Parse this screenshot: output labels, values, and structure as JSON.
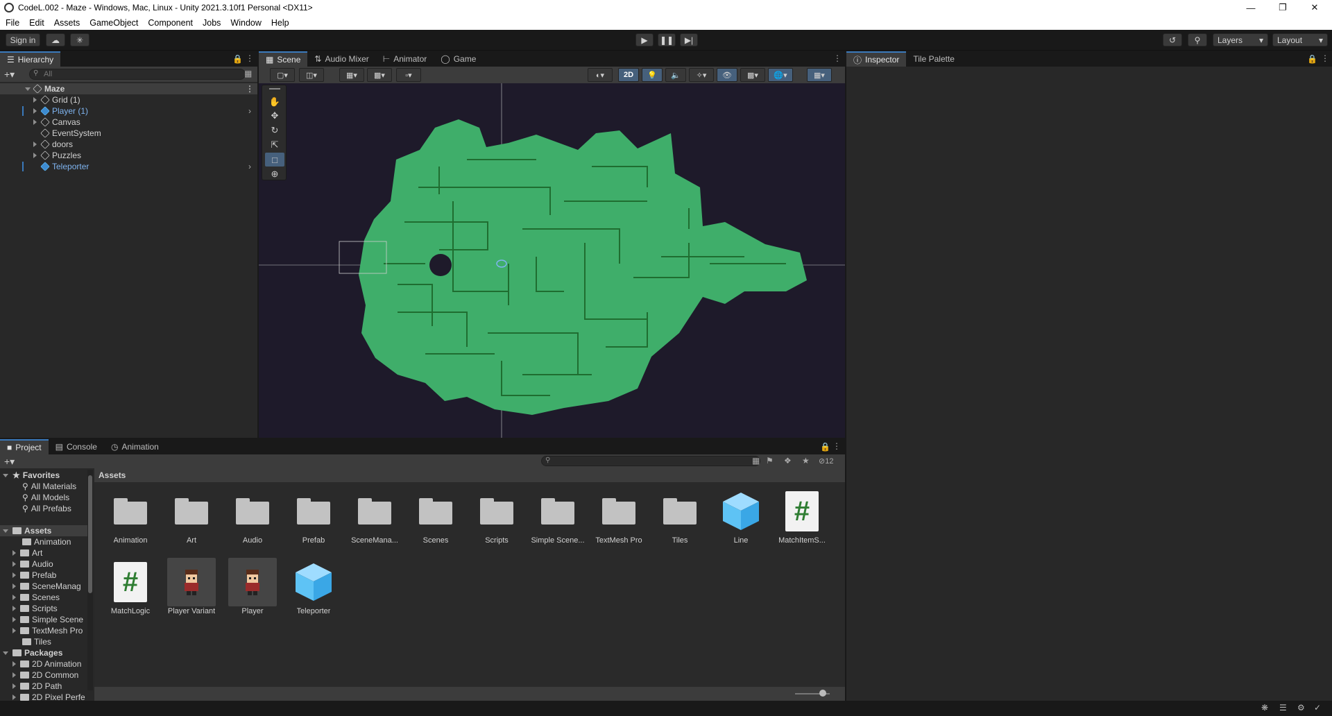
{
  "window": {
    "title": "CodeL.002 - Maze - Windows, Mac, Linux - Unity 2021.3.10f1 Personal <DX11>"
  },
  "menu": [
    "File",
    "Edit",
    "Assets",
    "GameObject",
    "Component",
    "Jobs",
    "Window",
    "Help"
  ],
  "toolbar": {
    "sign_in": "Sign in",
    "layers": "Layers",
    "layout": "Layout"
  },
  "hierarchy": {
    "tab": "Hierarchy",
    "search_placeholder": "All",
    "scene": "Maze",
    "items": [
      {
        "label": "Grid (1)",
        "blue": false,
        "arrow": true
      },
      {
        "label": "Player (1)",
        "blue": true,
        "arrow": true
      },
      {
        "label": "Canvas",
        "blue": false,
        "arrow": true
      },
      {
        "label": "EventSystem",
        "blue": false,
        "arrow": false
      },
      {
        "label": "doors",
        "blue": false,
        "arrow": true
      },
      {
        "label": "Puzzles",
        "blue": false,
        "arrow": true
      },
      {
        "label": "Teleporter",
        "blue": true,
        "arrow": false
      }
    ]
  },
  "scene_tabs": [
    "Scene",
    "Audio Mixer",
    "Animator",
    "Game"
  ],
  "scene_toolbar": {
    "mode_2d": "2D"
  },
  "inspector_tabs": [
    "Inspector",
    "Tile Palette"
  ],
  "project_tabs": [
    "Project",
    "Console",
    "Animation"
  ],
  "project": {
    "hidden_count": "12",
    "breadcrumb": "Assets",
    "favorites": {
      "label": "Favorites",
      "items": [
        "All Materials",
        "All Models",
        "All Prefabs"
      ]
    },
    "assets_root": "Assets",
    "asset_folders": [
      "Animation",
      "Art",
      "Audio",
      "Prefab",
      "SceneManag",
      "Scenes",
      "Scripts",
      "Simple Scene",
      "TextMesh Pro",
      "Tiles"
    ],
    "packages_root": "Packages",
    "packages": [
      "2D Animation",
      "2D Common",
      "2D Path",
      "2D Pixel Perfe"
    ],
    "grid": [
      {
        "label": "Animation",
        "kind": "folder"
      },
      {
        "label": "Art",
        "kind": "folder"
      },
      {
        "label": "Audio",
        "kind": "folder"
      },
      {
        "label": "Prefab",
        "kind": "folder"
      },
      {
        "label": "SceneMana...",
        "kind": "folder"
      },
      {
        "label": "Scenes",
        "kind": "folder"
      },
      {
        "label": "Scripts",
        "kind": "folder"
      },
      {
        "label": "Simple Scene...",
        "kind": "folder"
      },
      {
        "label": "TextMesh Pro",
        "kind": "folder"
      },
      {
        "label": "Tiles",
        "kind": "folder"
      },
      {
        "label": "Line",
        "kind": "prefab"
      },
      {
        "label": "MatchItemS...",
        "kind": "script"
      },
      {
        "label": "MatchLogic",
        "kind": "script"
      },
      {
        "label": "Player Variant",
        "kind": "sprite"
      },
      {
        "label": "Player",
        "kind": "sprite"
      },
      {
        "label": "Teleporter",
        "kind": "prefab"
      }
    ]
  },
  "colors": {
    "accent": "#3a79bb",
    "maze_green": "#3fae6a",
    "selected_blue": "#7fb4f0"
  }
}
